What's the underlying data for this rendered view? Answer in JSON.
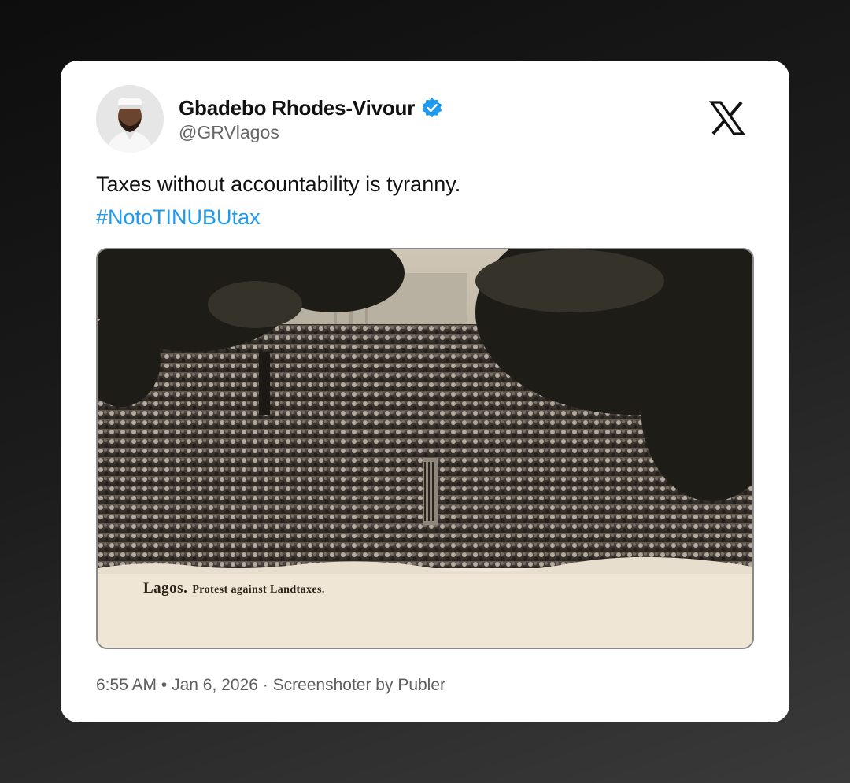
{
  "post": {
    "author": {
      "display_name": "Gbadebo Rhodes-Vivour",
      "handle": "@GRVlagos",
      "verified": true,
      "avatar_icon": "profile-photo"
    },
    "platform_icon": "x-logo-icon",
    "text": "Taxes without accountability is tyranny.",
    "hashtag": "#NotoTINUBUtax",
    "media": {
      "caption_place": "Lagos.",
      "caption_text": "Protest against Landtaxes."
    },
    "meta": {
      "time": "6:55 AM",
      "separator": "•",
      "date": "Jan 6, 2026",
      "dot": "·",
      "credit": "Screenshoter by Publer"
    }
  },
  "colors": {
    "hashtag": "#1d9bf0",
    "verified_badge": "#1d9bf0",
    "card_background": "#ffffff",
    "page_background": "#1c1c1c"
  }
}
